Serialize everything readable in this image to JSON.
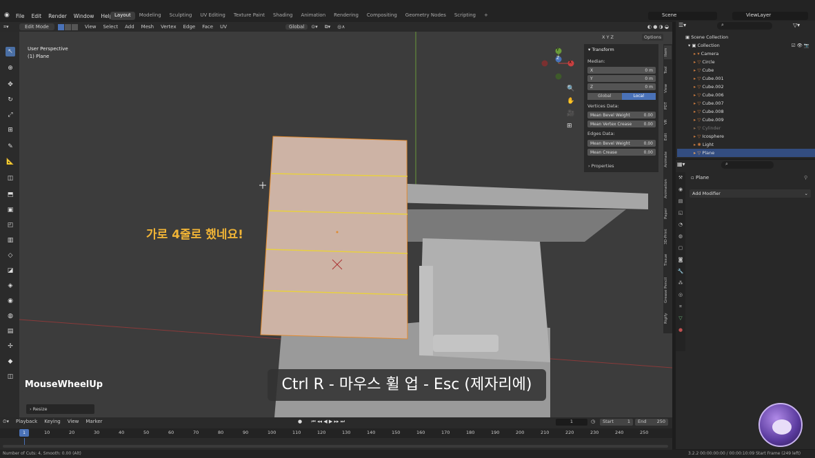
{
  "menu": {
    "items": [
      "File",
      "Edit",
      "Render",
      "Window",
      "Help"
    ]
  },
  "workspaces": [
    "Layout",
    "Modeling",
    "Sculpting",
    "UV Editing",
    "Texture Paint",
    "Shading",
    "Animation",
    "Rendering",
    "Compositing",
    "Geometry Nodes",
    "Scripting"
  ],
  "active_workspace": "Layout",
  "scene_name": "Scene",
  "view_layer": "ViewLayer",
  "header": {
    "mode": "Edit Mode",
    "menus": [
      "View",
      "Select",
      "Add",
      "Mesh",
      "Vertex",
      "Edge",
      "Face",
      "UV"
    ],
    "orientation": "Global",
    "options": "Options",
    "xyz": "X Y Z"
  },
  "viewport": {
    "view_name": "User Perspective",
    "object_name": "(1) Plane",
    "note_korean": "가로 4줄로 했네요!",
    "gizmo_axes": {
      "x": "X",
      "y": "Y",
      "z": "Z"
    }
  },
  "npanel": {
    "section_title": "Transform",
    "median_label": "Median:",
    "fields": [
      {
        "label": "X",
        "value": "0 m"
      },
      {
        "label": "Y",
        "value": "0 m"
      },
      {
        "label": "Z",
        "value": "0 m"
      }
    ],
    "global_label": "Global",
    "local_label": "Local",
    "vertices_data_label": "Vertices Data:",
    "vertex_fields": [
      {
        "label": "Mean Bevel Weight",
        "value": "0.00"
      },
      {
        "label": "Mean Vertex Crease",
        "value": "0.00"
      }
    ],
    "edges_data_label": "Edges Data:",
    "edge_fields": [
      {
        "label": "Mean Bevel Weight",
        "value": "0.00"
      },
      {
        "label": "Mean Crease",
        "value": "0.00"
      }
    ],
    "properties_label": "Properties",
    "side_tabs": [
      "Item",
      "Tool",
      "View",
      "PDT",
      "VR",
      "Edit",
      "Animate",
      "Animation",
      "Paper",
      "3D-Print",
      "Tissue",
      "Grease Pencil",
      "Rigify"
    ]
  },
  "outliner": {
    "scene_collection": "Scene Collection",
    "collection": "Collection",
    "items": [
      "Camera",
      "Circle",
      "Cube",
      "Cube.001",
      "Cube.002",
      "Cube.006",
      "Cube.007",
      "Cube.008",
      "Cube.009",
      "Cylinder",
      "Icosphere",
      "Light",
      "Plane"
    ],
    "selected": "Plane"
  },
  "properties": {
    "object_name": "Plane",
    "add_modifier": "Add Modifier"
  },
  "overlay": {
    "key_pressed": "MouseWheelUp",
    "subtitle": "Ctrl R - 마우스 휠 업 - Esc (제자리에)",
    "last_op": "Resize"
  },
  "timeline": {
    "menus": [
      "Playback",
      "Keying",
      "View",
      "Marker"
    ],
    "current_frame": "1",
    "start_label": "Start",
    "start_value": "1",
    "end_label": "End",
    "end_value": "250",
    "ticks": [
      "1",
      "10",
      "20",
      "30",
      "40",
      "50",
      "60",
      "70",
      "80",
      "90",
      "100",
      "110",
      "120",
      "130",
      "140",
      "150",
      "160",
      "170",
      "180",
      "190",
      "200",
      "210",
      "220",
      "230",
      "240",
      "250"
    ]
  },
  "status": {
    "left": "Number of Cuts: 4, Smooth: 0.00 (Alt)",
    "right": "3.2.2  00:00:00:00 / 00:00:10:09  Start Frame (249 left)"
  },
  "colors": {
    "accent": "#4a72b8",
    "note": "#f0b436",
    "loop_cut": "#e8d040",
    "plane_fill": "#c9aea0"
  }
}
